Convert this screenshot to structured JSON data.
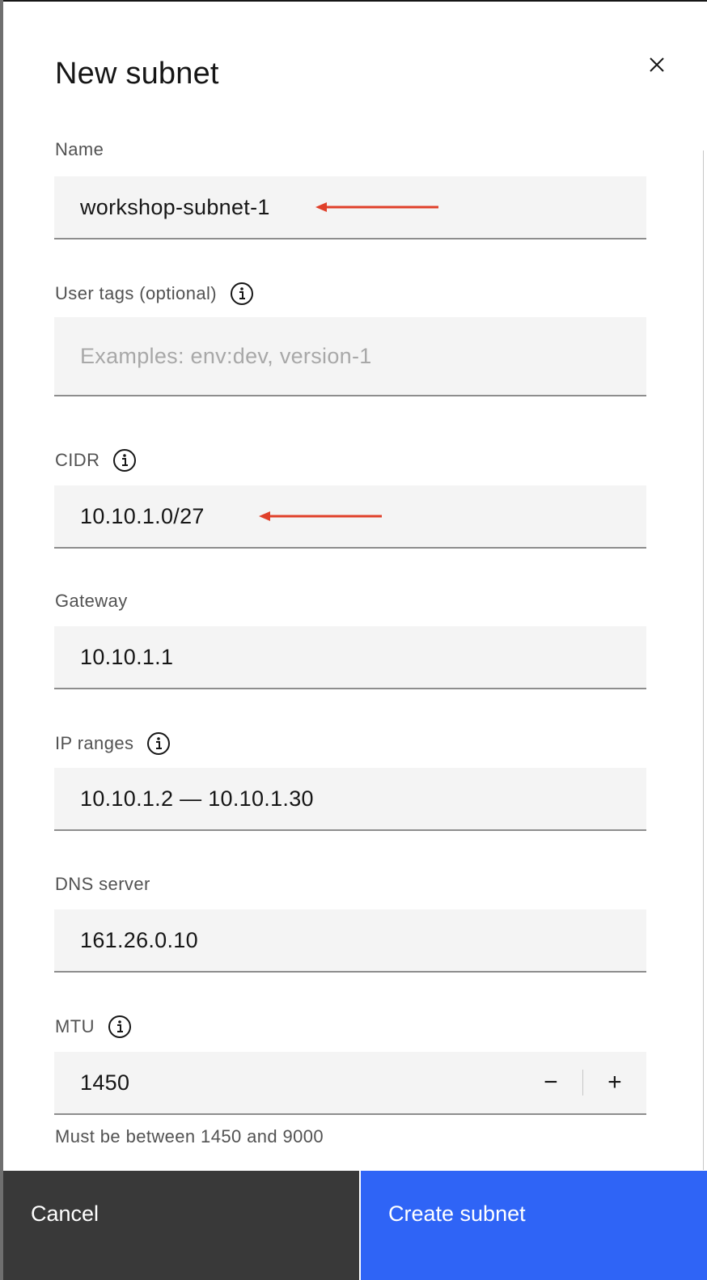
{
  "modal": {
    "title": "New subnet",
    "close_icon": "close-icon"
  },
  "fields": {
    "name": {
      "label": "Name",
      "value": "workshop-subnet-1"
    },
    "user_tags": {
      "label": "User tags (optional)",
      "placeholder": "Examples: env:dev, version-1"
    },
    "cidr": {
      "label": "CIDR",
      "value": "10.10.1.0/27"
    },
    "gateway": {
      "label": "Gateway",
      "value": "10.10.1.1"
    },
    "ip_ranges": {
      "label": "IP ranges",
      "value": "10.10.1.2 — 10.10.1.30"
    },
    "dns_server": {
      "label": "DNS server",
      "value": "161.26.0.10"
    },
    "mtu": {
      "label": "MTU",
      "value": "1450",
      "helper": "Must be between 1450 and 9000",
      "decrement": "−",
      "increment": "+"
    }
  },
  "footer": {
    "cancel_label": "Cancel",
    "primary_label": "Create subnet"
  },
  "colors": {
    "primary": "#2f64f6",
    "secondary": "#393939",
    "annotation_arrow": "#e0402a"
  }
}
